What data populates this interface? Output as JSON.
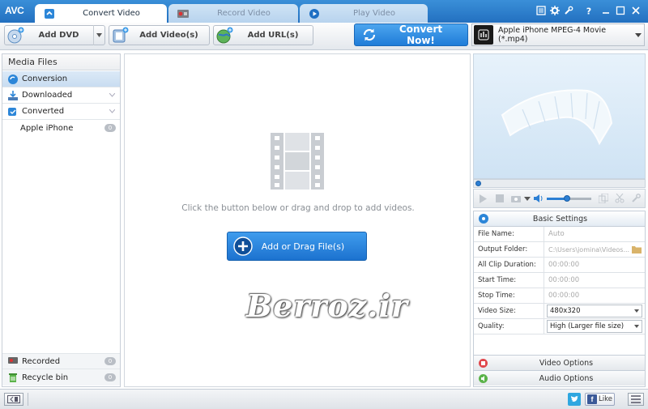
{
  "app": {
    "logo": "AVC"
  },
  "tabs": [
    {
      "label": "Convert Video",
      "icon": "convert-icon",
      "active": true
    },
    {
      "label": "Record Video",
      "icon": "record-icon",
      "active": false
    },
    {
      "label": "Play Video",
      "icon": "play-icon",
      "active": false
    }
  ],
  "window_controls": [
    "settings-icon",
    "gear-icon",
    "tools-icon",
    "help-icon",
    "minimize-icon",
    "maximize-icon",
    "close-icon"
  ],
  "toolbar": {
    "add_dvd": "Add DVD",
    "add_videos": "Add Video(s)",
    "add_urls": "Add URL(s)",
    "convert_now": "Convert Now!",
    "profile": "Apple iPhone MPEG-4 Movie (*.mp4)"
  },
  "sidebar": {
    "title": "Media Files",
    "items": [
      {
        "label": "Conversion",
        "icon": "conversion-icon"
      },
      {
        "label": "Downloaded",
        "icon": "download-icon"
      },
      {
        "label": "Converted",
        "icon": "converted-icon"
      },
      {
        "label": "Apple iPhone",
        "count": "0"
      }
    ],
    "bottom": [
      {
        "label": "Recorded",
        "count": "0",
        "icon": "recorded-icon"
      },
      {
        "label": "Recycle bin",
        "count": "0",
        "icon": "recycle-bin-icon"
      }
    ]
  },
  "main": {
    "hint": "Click the button below or drag and drop to add videos.",
    "add_button": "Add or Drag File(s)",
    "watermark": "Berroz.ir"
  },
  "player": {
    "volume": 0.45
  },
  "settings": {
    "title": "Basic Settings",
    "rows": [
      {
        "key": "File Name:",
        "value": "Auto"
      },
      {
        "key": "Output Folder:",
        "value": "C:\\Users\\jomina\\Videos..."
      },
      {
        "key": "All Clip Duration:",
        "value": "00:00:00"
      },
      {
        "key": "Start Time:",
        "value": "00:00:00"
      },
      {
        "key": "Stop Time:",
        "value": "00:00:00"
      },
      {
        "key": "Video Size:",
        "value": "480x320"
      },
      {
        "key": "Quality:",
        "value": "High (Larger file size)"
      }
    ],
    "video_options": "Video Options",
    "audio_options": "Audio Options"
  },
  "status": {
    "like": "Like"
  },
  "colors": {
    "accent": "#1f7cd8",
    "titlebar": "#2a7ccb"
  }
}
